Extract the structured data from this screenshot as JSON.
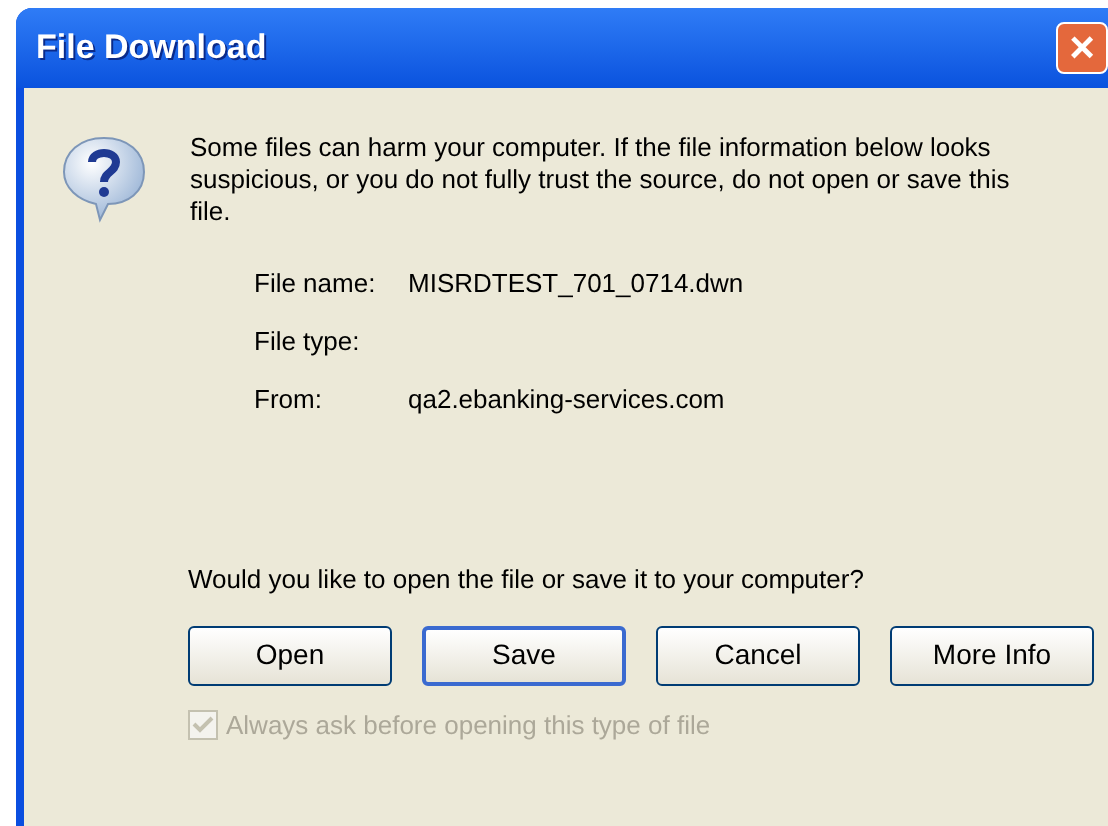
{
  "window": {
    "title": "File Download",
    "close": "×"
  },
  "message": "Some files can harm your computer. If the file information below looks suspicious, or you do not fully trust the source, do not open or save this file.",
  "file_info": [
    {
      "label": "File name:",
      "value": "MISRDTEST_701_0714.dwn"
    },
    {
      "label": "File type:"
    },
    {
      "label": "From:",
      "value": "qa2.ebanking-services.com"
    }
  ],
  "question": "Would you like to open the file or save it to your computer?",
  "buttons": [
    {
      "label": "Open",
      "default": false
    },
    {
      "label": "Save",
      "default": true
    },
    {
      "label": "Cancel",
      "default": false
    },
    {
      "label": "More Info",
      "default": false
    }
  ],
  "checkbox": {
    "label": "Always ask before opening this type of file",
    "checked": true,
    "disabled": true
  }
}
